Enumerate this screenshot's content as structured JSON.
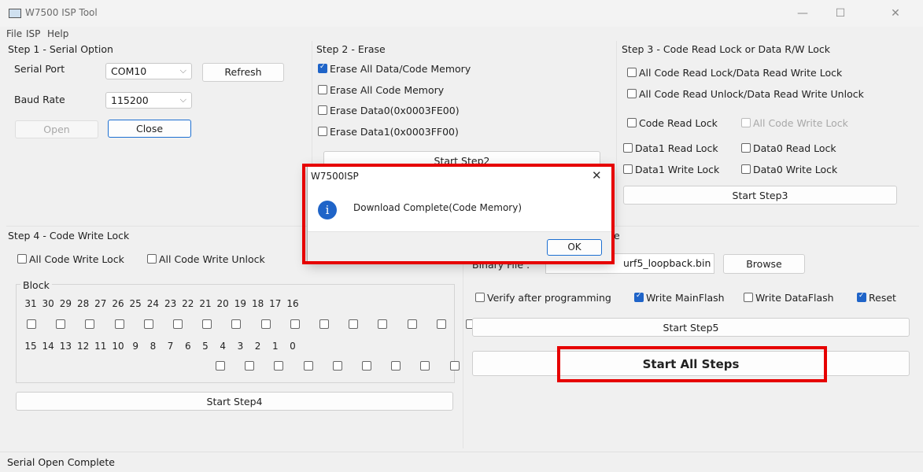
{
  "window": {
    "title": "W7500 ISP Tool",
    "minimize": "—",
    "maximize": "☐",
    "close": "✕"
  },
  "menu": [
    "File",
    "ISP",
    "Help"
  ],
  "step1": {
    "title": "Step 1 - Serial Option",
    "serial_port_label": "Serial Port",
    "serial_port_value": "COM10",
    "baud_rate_label": "Baud Rate",
    "baud_rate_value": "115200",
    "refresh": "Refresh",
    "open": "Open",
    "close": "Close"
  },
  "step2": {
    "title": "Step 2 - Erase",
    "options": [
      "Erase All Data/Code Memory",
      "Erase All Code Memory",
      "Erase Data0(0x0003FE00)",
      "Erase Data1(0x0003FF00)"
    ],
    "start": "Start Step2"
  },
  "step3": {
    "title": "Step 3 - Code Read Lock or Data R/W Lock",
    "opt1": "All Code Read Lock/Data Read Write Lock",
    "opt2": "All Code Read Unlock/Data Read Write Unlock",
    "code_read_lock": "Code Read Lock",
    "all_code_write_lock": "All Code Write Lock",
    "data1_read_lock": "Data1 Read Lock",
    "data0_read_lock": "Data0 Read Lock",
    "data1_write_lock": "Data1 Write Lock",
    "data0_write_lock": "Data0 Write Lock",
    "start": "Start Step3"
  },
  "step4": {
    "title": "Step 4 - Code Write Lock",
    "all_lock": "All Code Write Lock",
    "all_unlock": "All Code Write Unlock",
    "block_label": "Block",
    "row1": [
      "31",
      "30",
      "29",
      "28",
      "27",
      "26",
      "25",
      "24",
      "23",
      "22",
      "21",
      "20",
      "19",
      "18",
      "17",
      "16"
    ],
    "row2": [
      "15",
      "14",
      "13",
      "12",
      "11",
      "10",
      "9",
      "8",
      "7",
      "6",
      "5",
      "4",
      "3",
      "2",
      "1",
      "0"
    ],
    "start": "Start Step4"
  },
  "step5": {
    "title_tail": "e",
    "binary_label_partial": "Binary File :",
    "binary_value": "urf5_loopback.bin",
    "browse": "Browse",
    "verify": "Verify after programming",
    "write_main": "Write MainFlash",
    "write_data": "Write DataFlash",
    "reset": "Reset",
    "start": "Start Step5",
    "start_all": "Start All Steps"
  },
  "dialog": {
    "title": "W7500ISP",
    "message": "Download Complete(Code Memory)",
    "ok": "OK",
    "close": "✕",
    "info_glyph": "i"
  },
  "status": "Serial Open Complete",
  "colors": {
    "highlight": "#e60000",
    "checkbox": "#1f64c8",
    "info_icon": "#1f64c8"
  }
}
